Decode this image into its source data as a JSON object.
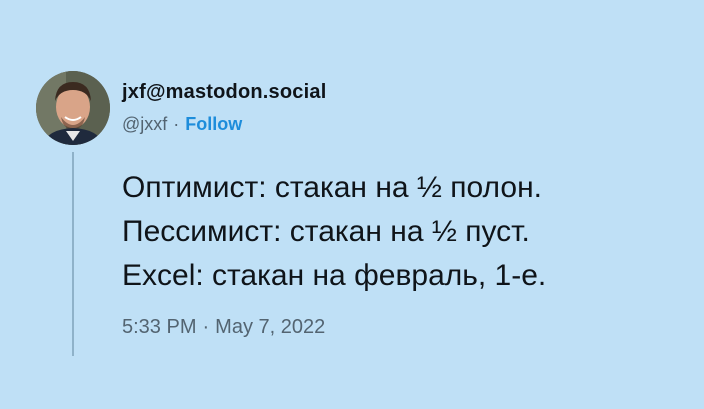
{
  "author": {
    "display_name": "jxf@mastodon.social",
    "handle": "@jxxf",
    "separator": "·",
    "follow_label": "Follow"
  },
  "tweet": {
    "lines": [
      "Оптимист: стакан на ½ полон.",
      "Пессимист: стакан на ½ пуст.",
      "Excel: стакан на февраль, 1-е."
    ]
  },
  "timestamp": {
    "time": "5:33 PM",
    "separator": "·",
    "date": "May 7, 2022"
  },
  "colors": {
    "background": "#bfe0f6",
    "link": "#1d8ddb",
    "text": "#0f1419",
    "muted": "#536471"
  }
}
